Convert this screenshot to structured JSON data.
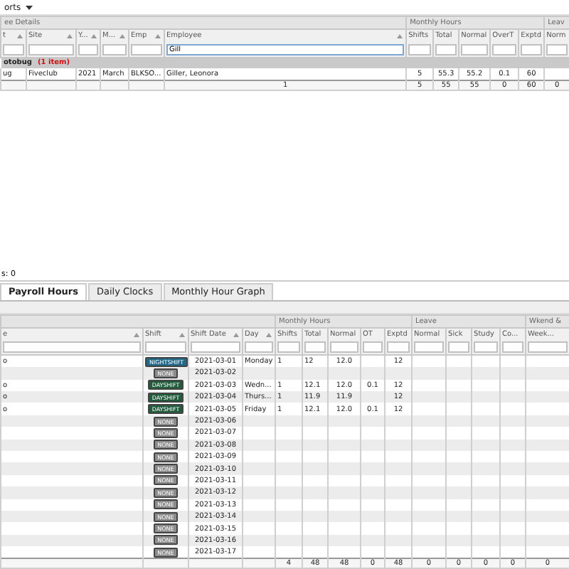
{
  "toolbar": {
    "menu_label": "orts"
  },
  "top_grid": {
    "groups": [
      {
        "label": "ee Details",
        "columns": [
          {
            "label": "t",
            "sort": true
          },
          {
            "label": "Site",
            "sort": true
          },
          {
            "label": "Y...",
            "sort": true
          },
          {
            "label": "M...",
            "sort": true
          },
          {
            "label": "Emp",
            "sort": true
          },
          {
            "label": "Employee",
            "sort": true,
            "filter": "Gill",
            "total": "1"
          }
        ]
      },
      {
        "label": "Monthly Hours",
        "columns": [
          {
            "label": "Shifts",
            "sort": false,
            "total": "5"
          },
          {
            "label": "Total",
            "sort": false,
            "total": "55"
          },
          {
            "label": "Normal",
            "sort": false,
            "total": "55"
          },
          {
            "label": "OverT",
            "sort": false,
            "total": "0"
          },
          {
            "label": "Exptd",
            "sort": false,
            "total": "60"
          }
        ]
      },
      {
        "label": "Leav",
        "columns": [
          {
            "label": "Norm",
            "sort": false,
            "total": "0"
          }
        ]
      }
    ],
    "group_row": {
      "label": "otobug",
      "count": "(1 item)"
    },
    "rows": [
      {
        "cells": [
          "ug",
          "Fiveclub",
          "2021",
          "March",
          "BLKSO...",
          "Giller, Leonora",
          "5",
          "55.3",
          "55.2",
          "0.1",
          "60",
          null
        ]
      }
    ]
  },
  "status": "s: 0",
  "tabs": [
    {
      "label": "Payroll Hours",
      "selected": true
    },
    {
      "label": "Daily Clocks",
      "selected": false
    },
    {
      "label": "Monthly Hour Graph",
      "selected": false
    }
  ],
  "bottom_grid": {
    "groups": [
      {
        "columns": [
          {
            "label": "e",
            "sort": true
          },
          {
            "label": "Shift",
            "sort": true
          },
          {
            "label": "Shift Date",
            "sort": true
          },
          {
            "label": "Day",
            "sort": true
          }
        ]
      },
      {
        "label": "Monthly Hours",
        "columns": [
          {
            "label": "Shifts",
            "sort": false,
            "total": "4"
          },
          {
            "label": "Total",
            "sort": false,
            "total": "48"
          },
          {
            "label": "Normal",
            "sort": false,
            "total": "48"
          },
          {
            "label": "OT",
            "sort": false,
            "total": "0"
          },
          {
            "label": "Exptd",
            "sort": false,
            "total": "48"
          }
        ]
      },
      {
        "label": "Leave",
        "columns": [
          {
            "label": "Normal",
            "sort": false,
            "total": "0"
          },
          {
            "label": "Sick",
            "sort": false,
            "total": "0"
          },
          {
            "label": "Study",
            "sort": false,
            "total": "0"
          },
          {
            "label": "Co...",
            "sort": false,
            "total": "0"
          }
        ]
      },
      {
        "label": "Wkend &",
        "columns": [
          {
            "label": "Week...",
            "sort": false,
            "total": "0"
          }
        ]
      }
    ],
    "rows": [
      {
        "cells": [
          "o",
          {
            "label": "NIGHTSHIFT",
            "color": "#1f6a8a"
          },
          "2021-03-01",
          "Monday",
          "1",
          "12",
          "12.0",
          null,
          "12",
          null,
          null,
          null,
          null,
          null
        ]
      },
      {
        "cells": [
          null,
          {
            "label": "NONE",
            "color": "#8c8c8c"
          },
          "2021-03-02",
          null,
          null,
          null,
          null,
          null,
          null,
          null,
          null,
          null,
          null,
          null
        ]
      },
      {
        "cells": [
          "o",
          {
            "label": "DAYSHIFT",
            "color": "#1e5c3c"
          },
          "2021-03-03",
          "Wedn...",
          "1",
          "12.1",
          "12.0",
          "0.1",
          "12",
          null,
          null,
          null,
          null,
          null
        ]
      },
      {
        "cells": [
          "o",
          {
            "label": "DAYSHIFT",
            "color": "#1e5c3c"
          },
          "2021-03-04",
          "Thurs...",
          "1",
          "11.9",
          "11.9",
          null,
          "12",
          null,
          null,
          null,
          null,
          null
        ]
      },
      {
        "cells": [
          "o",
          {
            "label": "DAYSHIFT",
            "color": "#1e5c3c"
          },
          "2021-03-05",
          "Friday",
          "1",
          "12.1",
          "12.0",
          "0.1",
          "12",
          null,
          null,
          null,
          null,
          null
        ]
      },
      {
        "cells": [
          null,
          {
            "label": "NONE",
            "color": "#8c8c8c"
          },
          "2021-03-06",
          null,
          null,
          null,
          null,
          null,
          null,
          null,
          null,
          null,
          null,
          null
        ]
      },
      {
        "cells": [
          null,
          {
            "label": "NONE",
            "color": "#8c8c8c"
          },
          "2021-03-07",
          null,
          null,
          null,
          null,
          null,
          null,
          null,
          null,
          null,
          null,
          null
        ]
      },
      {
        "cells": [
          null,
          {
            "label": "NONE",
            "color": "#8c8c8c"
          },
          "2021-03-08",
          null,
          null,
          null,
          null,
          null,
          null,
          null,
          null,
          null,
          null,
          null
        ]
      },
      {
        "cells": [
          null,
          {
            "label": "NONE",
            "color": "#8c8c8c"
          },
          "2021-03-09",
          null,
          null,
          null,
          null,
          null,
          null,
          null,
          null,
          null,
          null,
          null
        ]
      },
      {
        "cells": [
          null,
          {
            "label": "NONE",
            "color": "#8c8c8c"
          },
          "2021-03-10",
          null,
          null,
          null,
          null,
          null,
          null,
          null,
          null,
          null,
          null,
          null
        ]
      },
      {
        "cells": [
          null,
          {
            "label": "NONE",
            "color": "#8c8c8c"
          },
          "2021-03-11",
          null,
          null,
          null,
          null,
          null,
          null,
          null,
          null,
          null,
          null,
          null
        ]
      },
      {
        "cells": [
          null,
          {
            "label": "NONE",
            "color": "#8c8c8c"
          },
          "2021-03-12",
          null,
          null,
          null,
          null,
          null,
          null,
          null,
          null,
          null,
          null,
          null
        ]
      },
      {
        "cells": [
          null,
          {
            "label": "NONE",
            "color": "#8c8c8c"
          },
          "2021-03-13",
          null,
          null,
          null,
          null,
          null,
          null,
          null,
          null,
          null,
          null,
          null
        ]
      },
      {
        "cells": [
          null,
          {
            "label": "NONE",
            "color": "#8c8c8c"
          },
          "2021-03-14",
          null,
          null,
          null,
          null,
          null,
          null,
          null,
          null,
          null,
          null,
          null
        ]
      },
      {
        "cells": [
          null,
          {
            "label": "NONE",
            "color": "#8c8c8c"
          },
          "2021-03-15",
          null,
          null,
          null,
          null,
          null,
          null,
          null,
          null,
          null,
          null,
          null
        ]
      },
      {
        "cells": [
          null,
          {
            "label": "NONE",
            "color": "#8c8c8c"
          },
          "2021-03-16",
          null,
          null,
          null,
          null,
          null,
          null,
          null,
          null,
          null,
          null,
          null
        ]
      },
      {
        "cells": [
          null,
          {
            "label": "NONE",
            "color": "#8c8c8c"
          },
          "2021-03-17",
          null,
          null,
          null,
          null,
          null,
          null,
          null,
          null,
          null,
          null,
          null
        ]
      }
    ]
  }
}
